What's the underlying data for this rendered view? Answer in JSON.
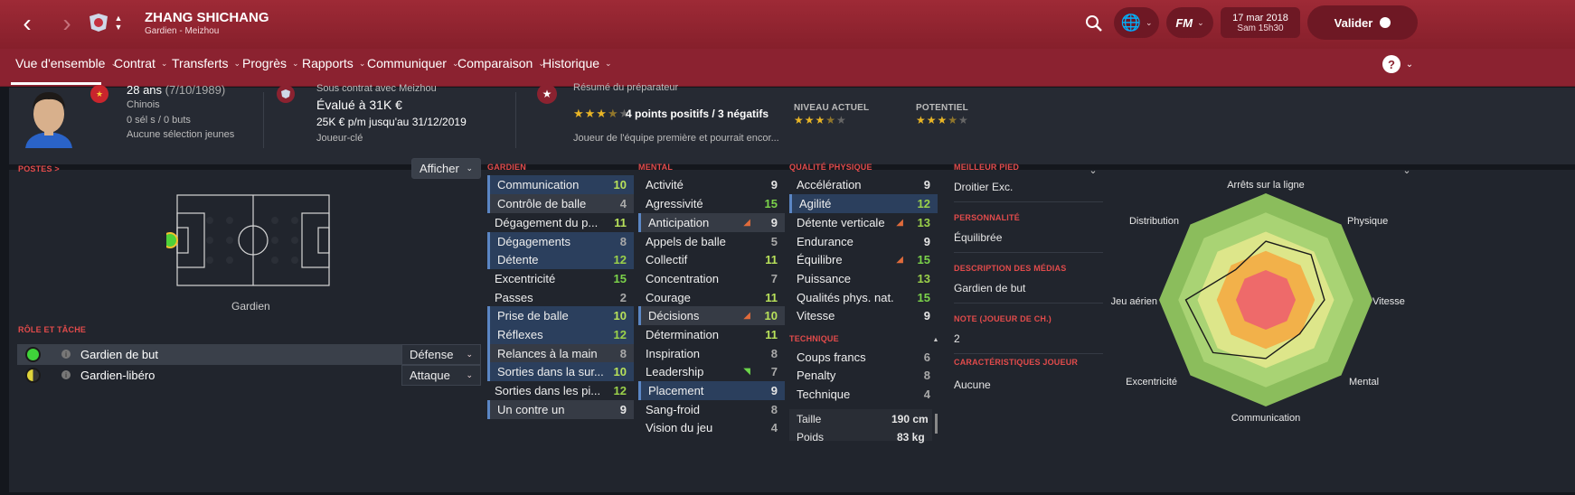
{
  "header": {
    "player_name": "ZHANG SHICHANG",
    "subtitle": "Gardien - Meizhou",
    "date": "17 mar 2018",
    "time": "Sam 15h30",
    "continue_label": "Valider",
    "fm_label": "FM"
  },
  "nav": {
    "items": [
      {
        "label": "Vue d'ensemble"
      },
      {
        "label": "Contrat"
      },
      {
        "label": "Transferts"
      },
      {
        "label": "Progrès"
      },
      {
        "label": "Rapports"
      },
      {
        "label": "Communiquer"
      },
      {
        "label": "Comparaison"
      },
      {
        "label": "Historique"
      }
    ],
    "help": "?"
  },
  "info": {
    "age": "28 ans",
    "birth": "(7/10/1989)",
    "nationality": "Chinois",
    "caps": "0 sél s / 0 buts",
    "youth": "Aucune sélection jeunes",
    "contract_title": "Sous contrat avec Meizhou",
    "value": "Évalué à 31K €",
    "wage": "25K € p/m jusqu'au 31/12/2019",
    "status": "Joueur-clé",
    "coach_title": "Résumé du préparateur",
    "coach_summary": "4 points positifs / 3 négatifs",
    "coach_note": "Joueur de l'équipe première et pourrait encor...",
    "current_label": "NIVEAU ACTUEL",
    "potential_label": "POTENTIEL",
    "current_stars": 3.5,
    "potential_stars": 3.5,
    "summary_stars": 3.5
  },
  "positions": {
    "label": "POSTES >",
    "show_button": "Afficher",
    "position_name": "Gardien"
  },
  "roles": {
    "label": "RÔLE ET TÂCHE",
    "items": [
      {
        "name": "Gardien de but",
        "duty": "Défense"
      },
      {
        "name": "Gardien-libéro",
        "duty": "Attaque"
      }
    ]
  },
  "goalkeeping": {
    "label": "GARDIEN",
    "items": [
      {
        "name": "Communication",
        "value": "10"
      },
      {
        "name": "Contrôle de balle",
        "value": "4"
      },
      {
        "name": "Dégagement du p...",
        "value": "11"
      },
      {
        "name": "Dégagements",
        "value": "8"
      },
      {
        "name": "Détente",
        "value": "12"
      },
      {
        "name": "Excentricité",
        "value": "15"
      },
      {
        "name": "Passes",
        "value": "2"
      },
      {
        "name": "Prise de balle",
        "value": "10"
      },
      {
        "name": "Réflexes",
        "value": "12"
      },
      {
        "name": "Relances à la main",
        "value": "8"
      },
      {
        "name": "Sorties dans la sur...",
        "value": "10"
      },
      {
        "name": "Sorties dans les pi...",
        "value": "12"
      },
      {
        "name": "Un contre un",
        "value": "9"
      }
    ]
  },
  "mental": {
    "label": "MENTAL",
    "items": [
      {
        "name": "Activité",
        "value": "9"
      },
      {
        "name": "Agressivité",
        "value": "15"
      },
      {
        "name": "Anticipation",
        "value": "9"
      },
      {
        "name": "Appels de balle",
        "value": "5"
      },
      {
        "name": "Collectif",
        "value": "11"
      },
      {
        "name": "Concentration",
        "value": "7"
      },
      {
        "name": "Courage",
        "value": "11"
      },
      {
        "name": "Décisions",
        "value": "10"
      },
      {
        "name": "Détermination",
        "value": "11"
      },
      {
        "name": "Inspiration",
        "value": "8"
      },
      {
        "name": "Leadership",
        "value": "7"
      },
      {
        "name": "Placement",
        "value": "9"
      },
      {
        "name": "Sang-froid",
        "value": "8"
      },
      {
        "name": "Vision du jeu",
        "value": "4"
      }
    ]
  },
  "physical": {
    "label": "QUALITÉ PHYSIQUE",
    "items": [
      {
        "name": "Accélération",
        "value": "9"
      },
      {
        "name": "Agilité",
        "value": "12"
      },
      {
        "name": "Détente verticale",
        "value": "13"
      },
      {
        "name": "Endurance",
        "value": "9"
      },
      {
        "name": "Équilibre",
        "value": "15"
      },
      {
        "name": "Puissance",
        "value": "13"
      },
      {
        "name": "Qualités phys. nat.",
        "value": "15"
      },
      {
        "name": "Vitesse",
        "value": "9"
      }
    ]
  },
  "technique": {
    "label": "TECHNIQUE",
    "items": [
      {
        "name": "Coups francs",
        "value": "6"
      },
      {
        "name": "Penalty",
        "value": "8"
      },
      {
        "name": "Technique",
        "value": "4"
      }
    ]
  },
  "body": {
    "height_label": "Taille",
    "height": "190 cm",
    "weight_label": "Poids",
    "weight": "83 kg"
  },
  "side": {
    "foot_label": "MEILLEUR PIED",
    "foot": "Droitier Exc.",
    "personality_label": "PERSONNALITÉ",
    "personality": "Équilibrée",
    "media_label": "DESCRIPTION DES MÉDIAS",
    "media": "Gardien de but",
    "rating_label": "NOTE (JOUEUR DE CH.)",
    "rating": "2",
    "traits_label": "CARACTÉRISTIQUES JOUEUR",
    "traits": "Aucune"
  },
  "radar": {
    "labels": [
      "Arrêts sur la ligne",
      "Physique",
      "Vitesse",
      "Mental",
      "Communication",
      "Excentricité",
      "Jeu aérien",
      "Distribution"
    ],
    "values": [
      0.55,
      0.6,
      0.55,
      0.45,
      0.55,
      0.7,
      0.75,
      0.4
    ]
  },
  "colors": {
    "accent": "#e24b4b",
    "header": "#9e2a36"
  }
}
